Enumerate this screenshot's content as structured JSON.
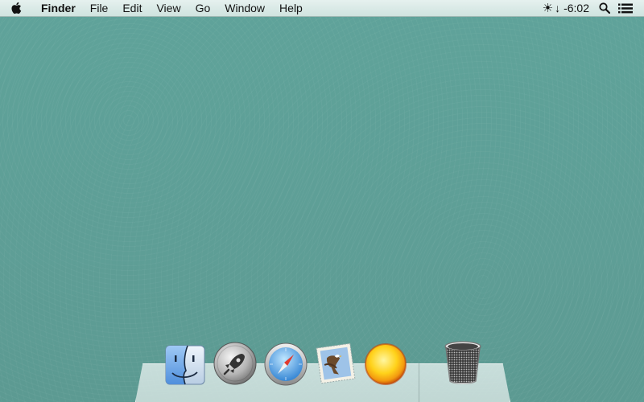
{
  "menubar": {
    "app_name": "Finder",
    "menus": [
      "File",
      "Edit",
      "View",
      "Go",
      "Window",
      "Help"
    ],
    "status": {
      "battery_symbol": "☀",
      "arrow_symbol": "↓",
      "time_text": "-6:02"
    },
    "icons": {
      "apple": "apple-icon",
      "spotlight": "search-icon",
      "notifications": "list-icon"
    }
  },
  "dock": {
    "items": [
      {
        "name": "Finder",
        "icon": "finder-icon"
      },
      {
        "name": "Launchpad",
        "icon": "rocket-icon"
      },
      {
        "name": "Safari",
        "icon": "compass-icon"
      },
      {
        "name": "Mail",
        "icon": "eagle-stamp-icon"
      },
      {
        "name": "Sun",
        "icon": "sun-icon"
      },
      {
        "name": "Trash",
        "icon": "trash-icon"
      }
    ]
  },
  "colors": {
    "desktop": "#5f9e96",
    "menubar": "#d9eae7"
  }
}
